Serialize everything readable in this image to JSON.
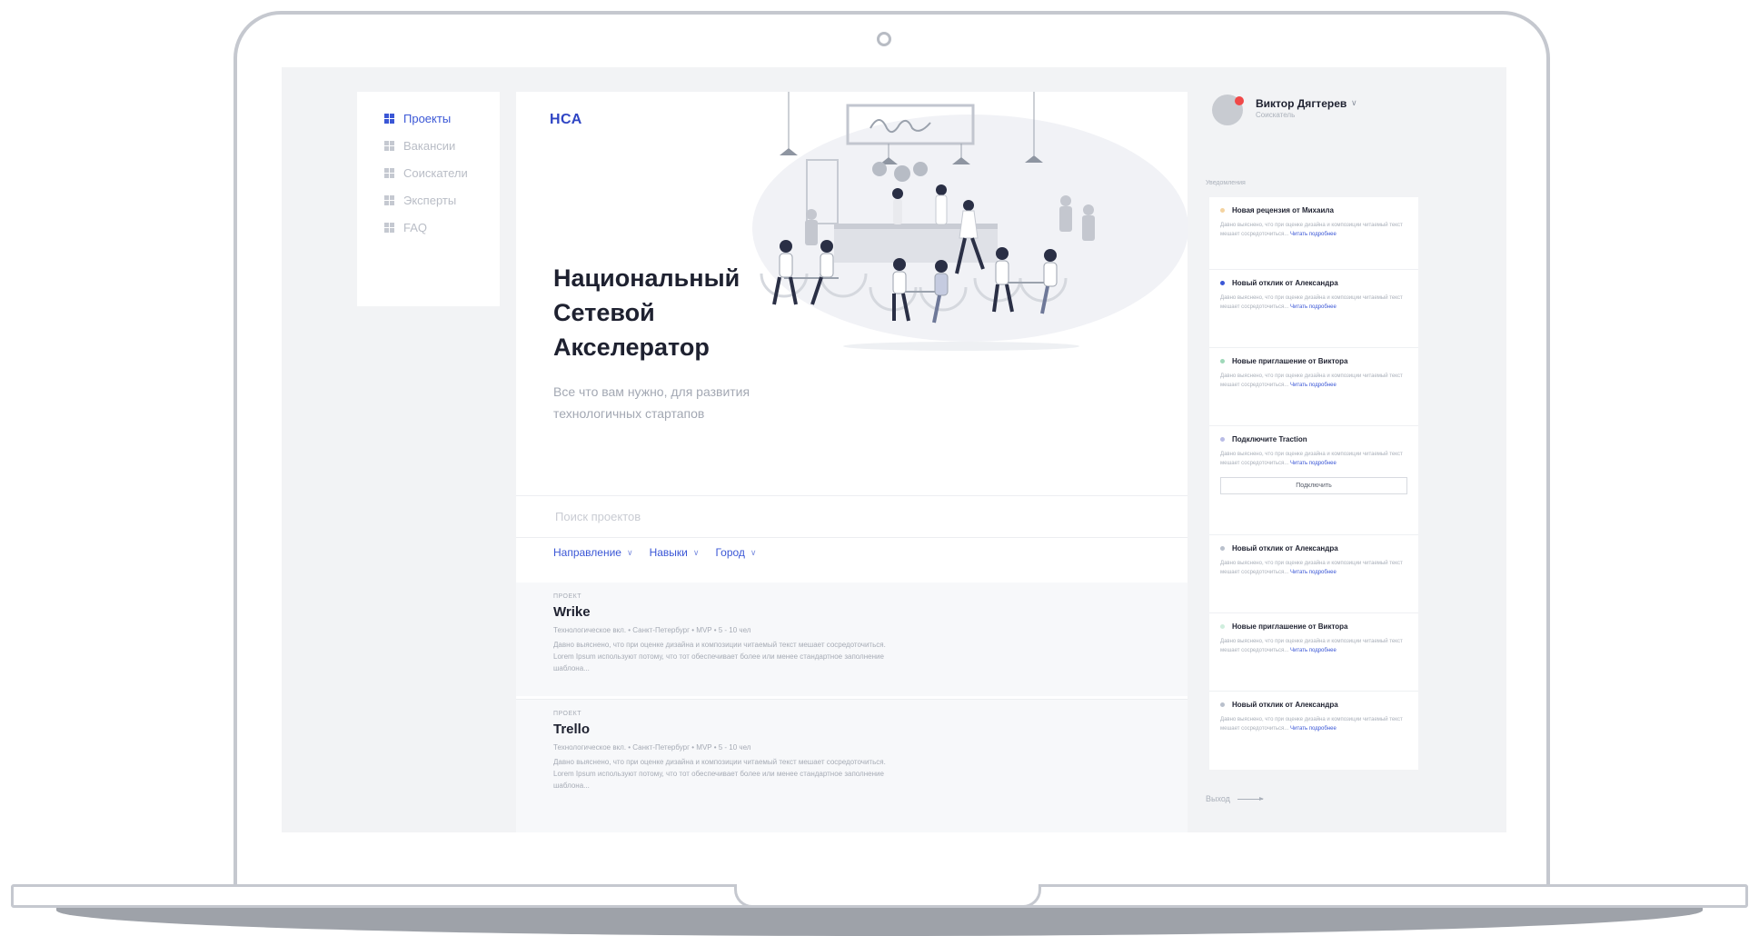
{
  "nav": {
    "items": [
      {
        "label": "Проекты",
        "active": true
      },
      {
        "label": "Вакансии",
        "active": false
      },
      {
        "label": "Соискатели",
        "active": false
      },
      {
        "label": "Эксперты",
        "active": false
      },
      {
        "label": "FAQ",
        "active": false
      }
    ]
  },
  "main": {
    "logo": "НСА",
    "hero_title": "Национальный Сетевой Акселератор",
    "hero_subtitle": "Все что вам нужно, для развития технологичных стартапов",
    "search_placeholder": "Поиск проектов",
    "filters": [
      "Направление",
      "Навыки",
      "Город"
    ],
    "projects": [
      {
        "kind": "ПРОЕКТ",
        "name": "Wrike",
        "meta": "Технологическое вкл. • Санкт-Петербург • MVP • 5 - 10 чел",
        "desc": "Давно выяснено, что при оценке дизайна и композиции читаемый текст мешает сосредоточиться. Lorem Ipsum используют потому, что тот обеспечивает более или менее стандартное заполнение шаблона..."
      },
      {
        "kind": "ПРОЕКТ",
        "name": "Trello",
        "meta": "Технологическое вкл. • Санкт-Петербург • MVP • 5 - 10 чел",
        "desc": "Давно выяснено, что при оценке дизайна и композиции читаемый текст мешает сосредоточиться. Lorem Ipsum используют потому, что тот обеспечивает более или менее стандартное заполнение шаблона..."
      }
    ]
  },
  "user": {
    "name": "Виктор Дягтерев",
    "role": "Соискатель"
  },
  "notifications_label": "Уведомления",
  "notifications": [
    {
      "title": "Новая рецензия от Михаила",
      "color": "#f4d3a0",
      "text": "Давно выяснено, что при оценке дизайна и композиции читаемый текст мешает сосредоточиться...",
      "more": "Читать подробнее"
    },
    {
      "title": "Новый отклик от Александра",
      "color": "#3b57d6",
      "text": "Давно выяснено, что при оценке дизайна и композиции читаемый текст мешает сосредоточиться...",
      "more": "Читать подробнее"
    },
    {
      "title": "Новые приглашение от Виктора",
      "color": "#9fd8b9",
      "text": "Давно выяснено, что при оценке дизайна и композиции читаемый текст мешает сосредоточиться...",
      "more": "Читать подробнее"
    },
    {
      "title": "Подключите Traction",
      "color": "#b9bce6",
      "text": "Давно выяснено, что при оценке дизайна и композиции читаемый текст мешает сосредоточиться...",
      "more": "Читать подробнее",
      "button": "Подключить"
    },
    {
      "title": "Новый отклик от Александра",
      "color": "#b9c0cc",
      "text": "Давно выяснено, что при оценке дизайна и композиции читаемый текст мешает сосредоточиться...",
      "more": "Читать подробнее"
    },
    {
      "title": "Новые приглашение от Виктора",
      "color": "#cfeedd",
      "text": "Давно выяснено, что при оценке дизайна и композиции читаемый текст мешает сосредоточиться...",
      "more": "Читать подробнее"
    },
    {
      "title": "Новый отклик от Александра",
      "color": "#b9c0cc",
      "text": "Давно выяснено, что при оценке дизайна и композиции читаемый текст мешает сосредоточиться...",
      "more": "Читать подробнее"
    }
  ],
  "logout": "Выход"
}
